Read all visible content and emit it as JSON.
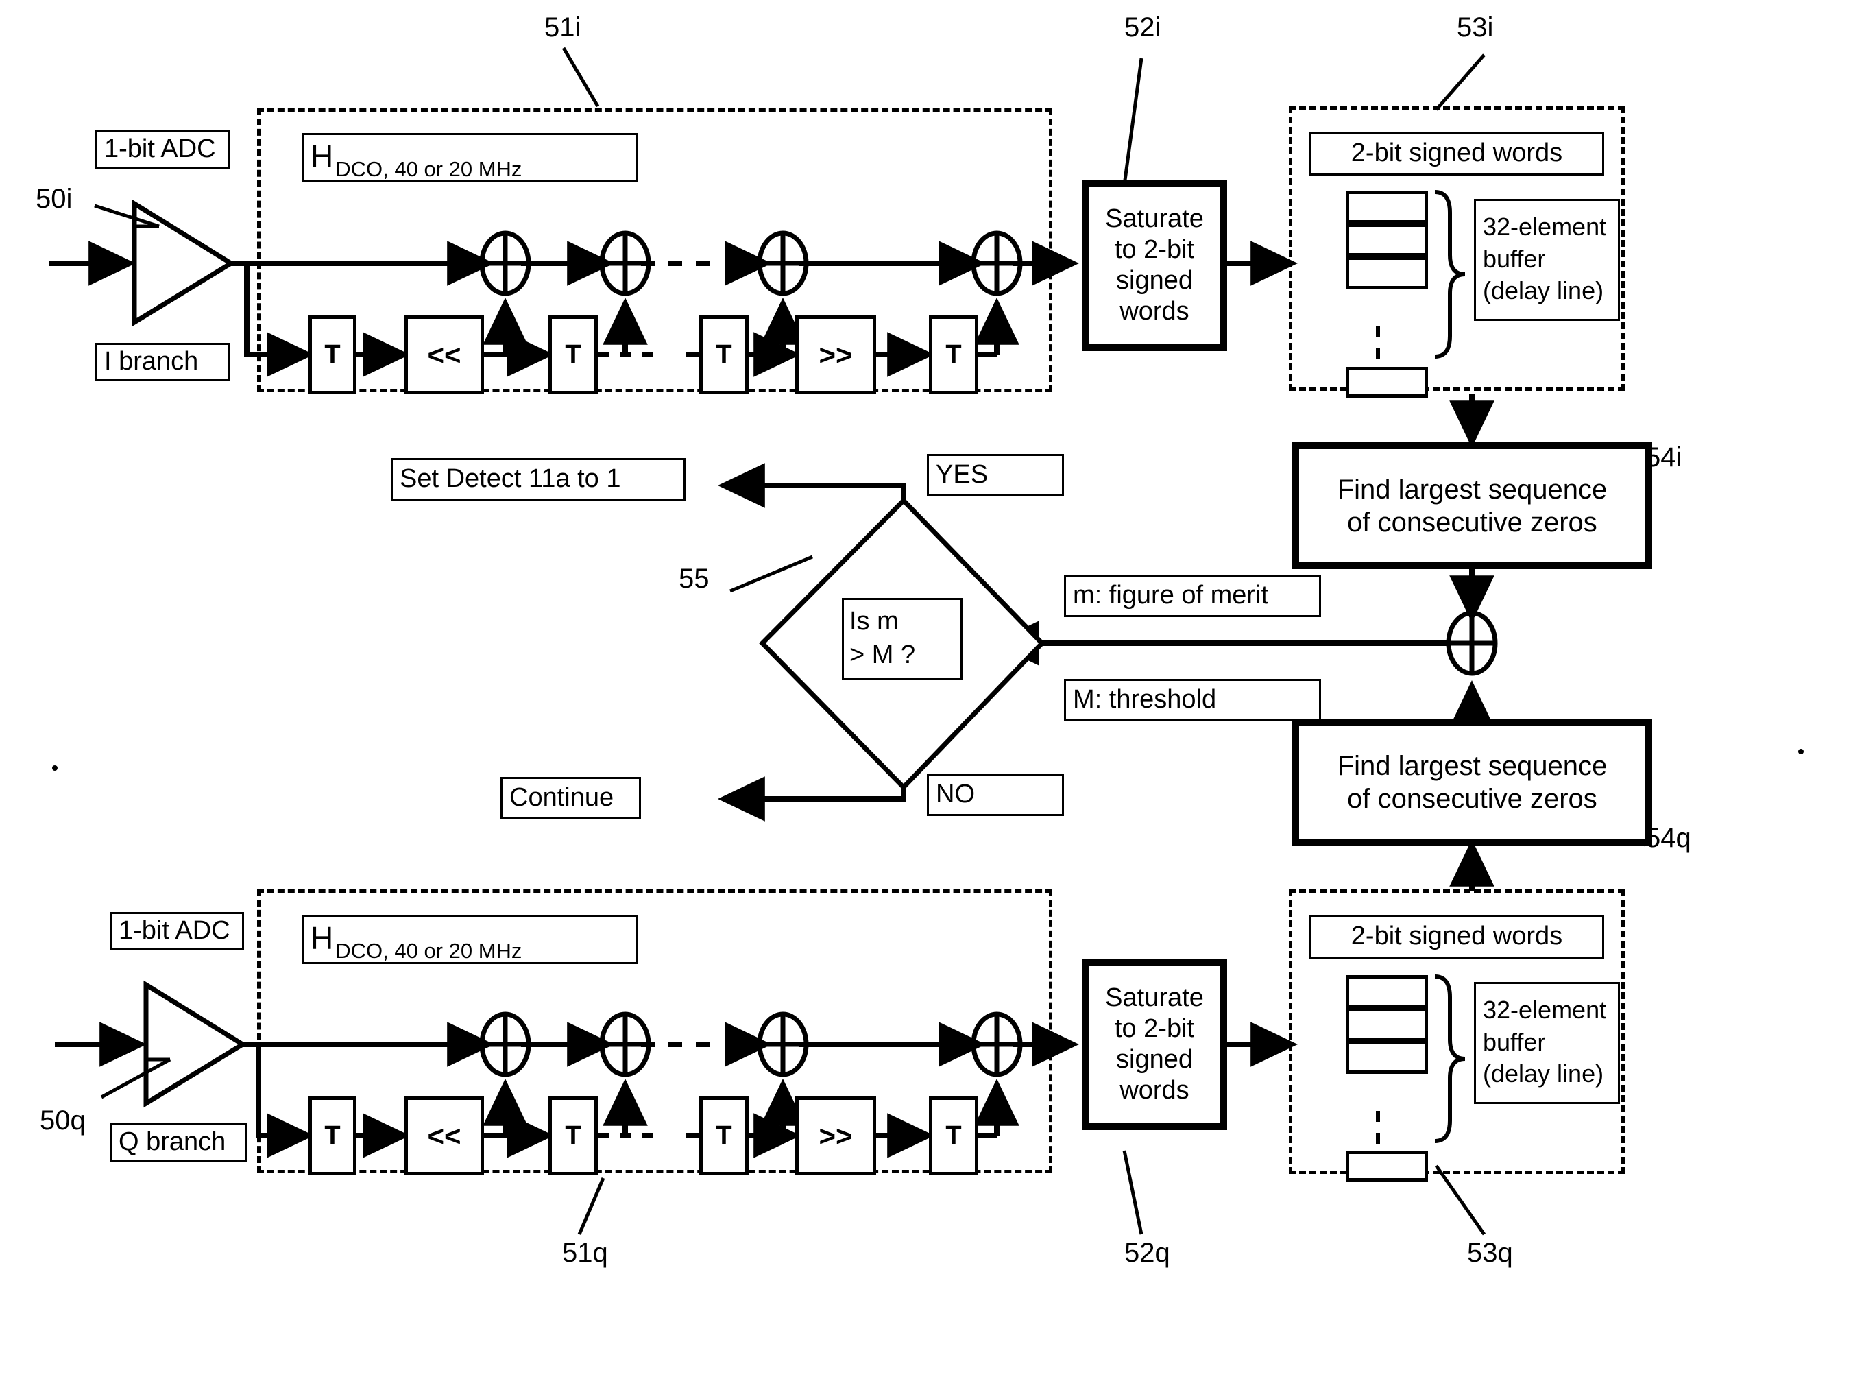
{
  "figure": {
    "title": "I/Q branch DCO filter, saturation, delay-line buffer and zero-run detection block diagram"
  },
  "i_branch": {
    "ref": "50i",
    "adc_label": "1-bit ADC",
    "branch_label": "I branch",
    "filter_ref": "51i",
    "filter_title_main": "H",
    "filter_title_sub": "DCO, 40 or 20 MHz",
    "taps": [
      "T",
      "<<",
      "T",
      "T",
      ">>",
      "T"
    ],
    "saturate_ref": "52i",
    "saturate_label": "Saturate\nto 2-bit\nsigned\nwords",
    "buffer_ref": "53i",
    "buffer_word_label": "2-bit signed words",
    "buffer_desc": "32-element\nbuffer\n(delay line)",
    "detector_ref": "54i",
    "detector_label": "Find largest sequence\nof consecutive zeros"
  },
  "q_branch": {
    "ref": "50q",
    "adc_label": "1-bit ADC",
    "branch_label": "Q branch",
    "filter_ref": "51q",
    "filter_title_main": "H",
    "filter_title_sub": "DCO, 40 or 20 MHz",
    "taps": [
      "T",
      "<<",
      "T",
      "T",
      ">>",
      "T"
    ],
    "saturate_ref": "52q",
    "saturate_label": "Saturate\nto 2-bit\nsigned\nwords",
    "buffer_ref": "53q",
    "buffer_word_label": "2-bit signed words",
    "buffer_desc": "32-element\nbuffer\n(delay line)",
    "detector_ref": "54q",
    "detector_label": "Find largest sequence\nof consecutive zeros"
  },
  "decision": {
    "ref": "55",
    "question_line1": "Is m",
    "question_line2": "> M ?",
    "yes_label": "YES",
    "no_label": "NO",
    "yes_target": "Set Detect 11a to 1",
    "no_target": "Continue"
  },
  "signals": {
    "merit": "m: figure of merit",
    "threshold": "M: threshold"
  },
  "colors": {
    "ink": "#000000",
    "paper": "#ffffff"
  }
}
